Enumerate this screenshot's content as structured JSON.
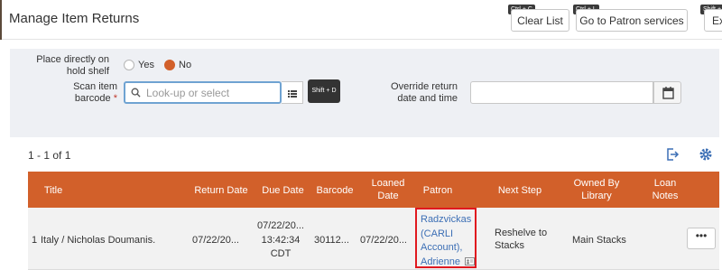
{
  "header": {
    "title": "Manage Item Returns",
    "buttons": [
      {
        "label": "Clear List",
        "shortcut": "Ctrl + C"
      },
      {
        "label": "Go to Patron services",
        "shortcut": "Ctrl + L"
      },
      {
        "label": "Ex",
        "shortcut": "Shift +"
      }
    ]
  },
  "form": {
    "hold_shelf_label": "Place directly on hold shelf",
    "yes_label": "Yes",
    "no_label": "No",
    "hold_shelf_selected": "No",
    "scan_label": "Scan item barcode",
    "required_mark": "*",
    "scan_placeholder": "Look-up or select",
    "scan_value": "",
    "shortcut_badge": "Shift + D",
    "override_label": "Override return date and time",
    "override_value": ""
  },
  "results": {
    "count": "1 - 1 of 1"
  },
  "table": {
    "headers": [
      "Title",
      "Return Date",
      "Due Date",
      "Barcode",
      "Loaned Date",
      "Patron",
      "Next Step",
      "Owned By Library",
      "Loan Notes"
    ],
    "rows": [
      {
        "index": "1",
        "title": "Italy / Nicholas Doumanis.",
        "return_date": "07/22/20...",
        "due_date": "07/22/20... 13:42:34 CDT",
        "barcode": "30112...",
        "loaned_date": "07/22/20...",
        "patron": "Radzvickas (CARLI Account), Adrienne",
        "next_step": "Reshelve to Stacks",
        "owned_by": "Main Stacks",
        "actions_label": "•••"
      }
    ]
  },
  "colors": {
    "accent": "#d2602a",
    "link": "#3c6fb5",
    "highlight": "#e0191f",
    "panel": "#eef0f4"
  },
  "icons": [
    "search-icon",
    "list-icon",
    "calendar-icon",
    "export-icon",
    "settings-icon",
    "patron-card-icon",
    "more-icon"
  ]
}
